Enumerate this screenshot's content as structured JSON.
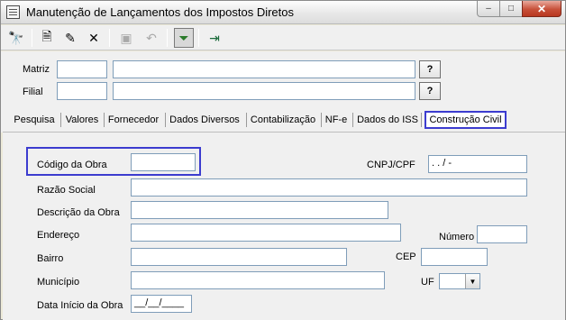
{
  "window": {
    "title": "Manutenção de Lançamentos dos Impostos Diretos",
    "controls": {
      "minimize": "–",
      "maximize": "□",
      "close": "✕"
    }
  },
  "toolbar": {
    "items": [
      {
        "name": "search",
        "icon": "binoculars-icon",
        "glyph": "🔭"
      },
      {
        "name": "new",
        "icon": "new-document-icon",
        "glyph": "🗎"
      },
      {
        "name": "edit",
        "icon": "edit-icon",
        "glyph": "✎"
      },
      {
        "name": "delete",
        "icon": "delete-icon",
        "glyph": "✕"
      },
      {
        "name": "save",
        "icon": "save-icon",
        "glyph": "▣"
      },
      {
        "name": "undo",
        "icon": "undo-icon",
        "glyph": "↶"
      },
      {
        "name": "filter",
        "icon": "filter-icon",
        "glyph": "⏷"
      },
      {
        "name": "exit",
        "icon": "exit-icon",
        "glyph": "⇥"
      }
    ]
  },
  "header": {
    "matriz_label": "Matriz",
    "filial_label": "Filial",
    "matriz_code": "",
    "matriz_name": "",
    "filial_code": "",
    "filial_name": "",
    "lookup_label": "?"
  },
  "tabs": [
    {
      "label": "Pesquisa"
    },
    {
      "label": "Valores"
    },
    {
      "label": "Fornecedor"
    },
    {
      "label": "Dados Diversos"
    },
    {
      "label": "Contabilização"
    },
    {
      "label": "NF-e"
    },
    {
      "label": "Dados do ISS"
    },
    {
      "label": "Construção Civil",
      "active": true
    }
  ],
  "form": {
    "codigo_obra_label": "Código da Obra",
    "codigo_obra_value": "",
    "cnpj_label": "CNPJ/CPF",
    "cnpj_value": " .  .  /  -",
    "razao_social_label": "Razão Social",
    "razao_social_value": "",
    "descricao_label": "Descrição da Obra",
    "descricao_value": "",
    "endereco_label": "Endereço",
    "endereco_value": "",
    "numero_label": "Número",
    "numero_value": "",
    "bairro_label": "Bairro",
    "bairro_value": "",
    "cep_label": "CEP",
    "cep_value": "",
    "municipio_label": "Município",
    "municipio_value": "",
    "uf_label": "UF",
    "uf_value": "",
    "data_inicio_label": "Data Início da Obra",
    "data_inicio_value": "__/__/____"
  },
  "colors": {
    "highlight": "#3c3ccf",
    "field_border": "#7f9db9"
  }
}
